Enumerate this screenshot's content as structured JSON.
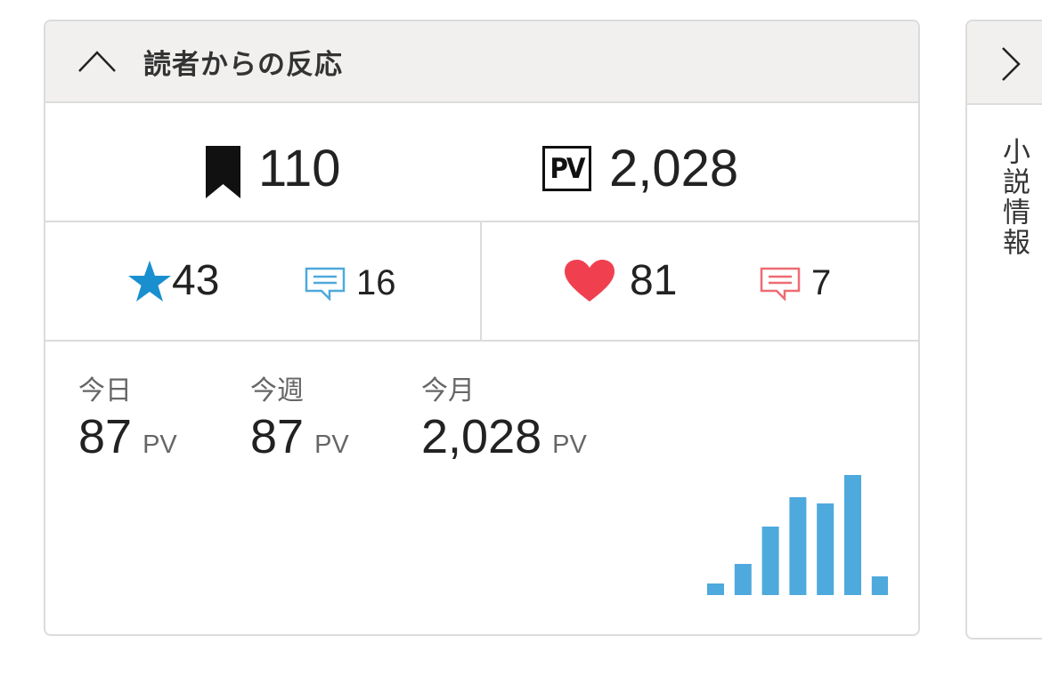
{
  "reactions": {
    "title": "読者からの反応",
    "bookmarks": "110",
    "page_views": "2,028",
    "pv_badge": "PV",
    "stars": "43",
    "star_comments": "16",
    "hearts": "81",
    "heart_comments": "7",
    "periods": [
      {
        "label": "今日",
        "value": "87",
        "unit": "PV"
      },
      {
        "label": "今週",
        "value": "87",
        "unit": "PV"
      },
      {
        "label": "今月",
        "value": "2,028",
        "unit": "PV"
      }
    ]
  },
  "chart_data": {
    "type": "bar",
    "values": [
      13,
      35,
      77,
      110,
      103,
      135,
      21
    ]
  },
  "side_panel": {
    "title": "小説情報"
  },
  "colors": {
    "star": "#1a8fd0",
    "heart": "#f0404f",
    "comment_blue": "#4fa9dc",
    "comment_red": "#ee6b73",
    "bar": "#4ea9dd"
  }
}
